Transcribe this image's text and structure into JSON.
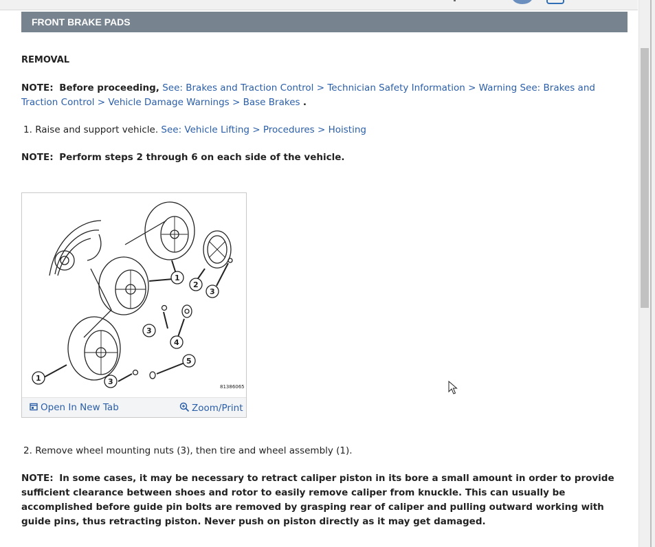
{
  "header": {
    "title": "FRONT BRAKE PADS"
  },
  "section": {
    "removal": "REMOVAL"
  },
  "note1": {
    "label": "NOTE:",
    "text": "Before proceeding,",
    "link1": "See: Brakes and Traction Control > Technician Safety Information > Warning",
    "link2": "See: Brakes and Traction Control > Vehicle Damage Warnings > Base Brakes",
    "end": "."
  },
  "step1": {
    "num": "1.",
    "text": "Raise and support vehicle.",
    "link": "See: Vehicle Lifting > Procedures > Hoisting"
  },
  "note2": {
    "label": "NOTE:",
    "text": "Perform steps 2 through 6 on each side of the vehicle."
  },
  "figure": {
    "code": "81386065",
    "callouts": [
      "1",
      "2",
      "3",
      "1",
      "3",
      "4",
      "5",
      "1",
      "3"
    ],
    "open_tab": "Open In New Tab",
    "zoom_print": "Zoom/Print"
  },
  "step2": {
    "num": "2.",
    "text": "Remove wheel mounting nuts (3), then tire and wheel assembly (1)."
  },
  "note3": {
    "label": "NOTE:",
    "text": "In some cases, it may be necessary to retract caliper piston in its bore a small amount in order to provide sufficient clearance between shoes and rotor to easily remove caliper from knuckle. This can usually be accomplished before guide pin bolts are removed by grasping rear of caliper and pulling outward working with guide pins, thus retracting piston. Never push on piston directly as it may get damaged."
  }
}
